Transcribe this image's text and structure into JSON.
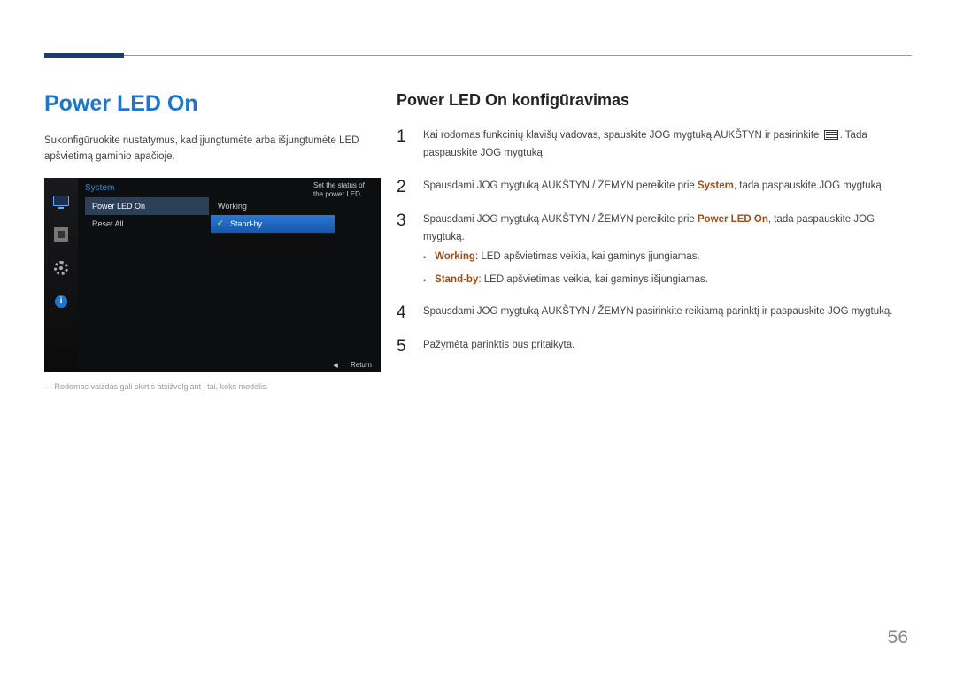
{
  "page_number": "56",
  "left": {
    "title": "Power LED On",
    "intro": "Sukonfigūruokite nustatymus, kad įjungtumėte arba išjungtumėte LED apšvietimą gaminio apačioje.",
    "footnote": "― Rodomas vaizdas gali skirtis atsižvelgiant į tai, koks modelis.",
    "osd": {
      "header": "System",
      "help_text": "Set the status of the power LED.",
      "col1": {
        "item1": "Power LED On",
        "item2": "Reset All"
      },
      "col2": {
        "item1": "Working",
        "item2": "Stand-by"
      },
      "footer_return": "Return"
    }
  },
  "right": {
    "title": "Power LED On konfigūravimas",
    "steps": {
      "n1": "1",
      "s1a": "Kai rodomas funkcinių klavišų vadovas, spauskite JOG mygtuką AUKŠTYN ir pasirinkite ",
      "s1b": ". Tada paspauskite JOG mygtuką.",
      "n2": "2",
      "s2a": "Spausdami JOG mygtuką AUKŠTYN / ŽEMYN pereikite prie ",
      "s2b_highlight": "System",
      "s2c": ", tada paspauskite JOG mygtuką.",
      "n3": "3",
      "s3a": "Spausdami JOG mygtuką AUKŠTYN / ŽEMYN pereikite prie ",
      "s3b_highlight": "Power LED On",
      "s3c": ", tada paspauskite JOG mygtuką.",
      "bullet1_label": "Working",
      "bullet1_text": ": LED apšvietimas veikia, kai gaminys įjungiamas.",
      "bullet2_label": "Stand-by",
      "bullet2_text": ": LED apšvietimas veikia, kai gaminys išjungiamas.",
      "n4": "4",
      "s4": "Spausdami JOG mygtuką AUKŠTYN / ŽEMYN pasirinkite reikiamą parinktį ir paspauskite JOG mygtuką.",
      "n5": "5",
      "s5": "Pažymėta parinktis bus pritaikyta."
    }
  }
}
